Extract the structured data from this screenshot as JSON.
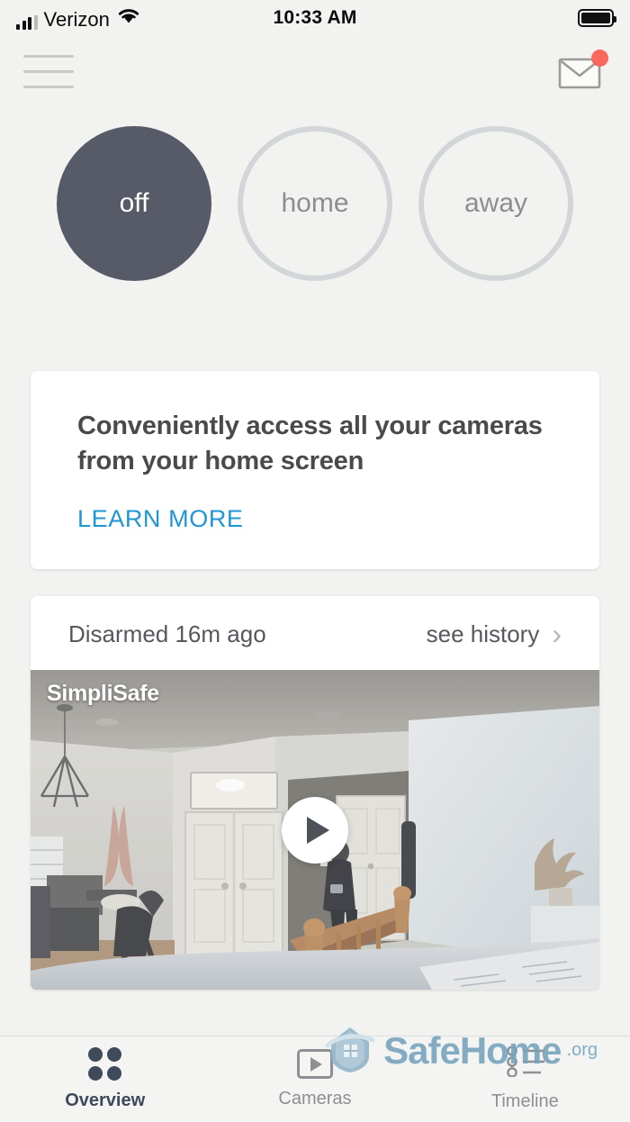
{
  "status_bar": {
    "carrier": "Verizon",
    "time": "10:33 AM",
    "signal_icon": "cellular-bars-icon",
    "wifi_icon": "wifi-icon",
    "battery_icon": "battery-full-icon"
  },
  "app_bar": {
    "menu_icon": "hamburger-menu-icon",
    "mail_icon": "envelope-icon",
    "notification_badge_color": "#f8685c"
  },
  "modes": {
    "selected": "off",
    "options": [
      {
        "label": "off",
        "state": "active"
      },
      {
        "label": "home",
        "state": "inactive"
      },
      {
        "label": "away",
        "state": "inactive"
      }
    ],
    "active_fill": "#565b67",
    "inactive_border": "#d3d6d8",
    "inactive_text": "#8b8e91"
  },
  "promo_card": {
    "title": "Conveniently access all your cameras from your home screen",
    "link_label": "LEARN MORE",
    "link_color": "#2196d4"
  },
  "camera_card": {
    "status_text": "Disarmed 16m ago",
    "history_label": "see history",
    "chevron_icon": "chevron-right-icon",
    "video": {
      "watermark": "SimpliSafe",
      "play_icon": "play-button-icon"
    }
  },
  "tab_bar": {
    "tabs": [
      {
        "label": "Overview",
        "icon": "grid-dots-icon",
        "state": "active"
      },
      {
        "label": "Cameras",
        "icon": "video-play-box-icon",
        "state": "inactive"
      },
      {
        "label": "Timeline",
        "icon": "timeline-icon",
        "state": "inactive"
      }
    ],
    "active_color": "#3f4a5a",
    "inactive_color": "#8d9095"
  },
  "watermark_logo": {
    "name": "SafeHome",
    "suffix": ".org",
    "icon": "house-shield-icon",
    "color": "#74a3bd"
  }
}
